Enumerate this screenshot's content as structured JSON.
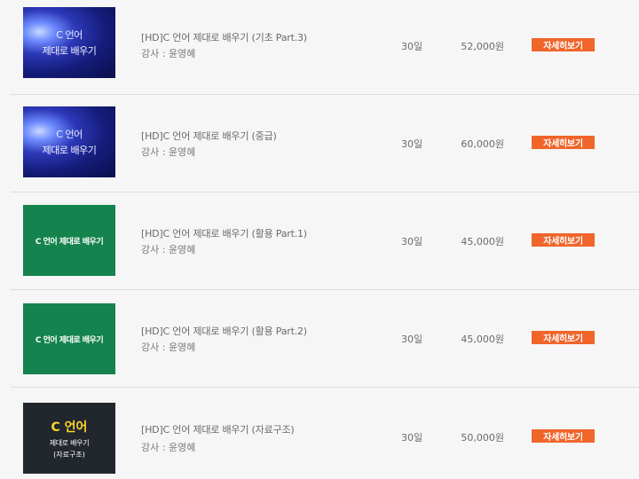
{
  "courses": [
    {
      "thumb_lines": [
        "C 언어",
        "제대로 배우기"
      ],
      "title": "[HD]C 언어 제대로 배우기 (기초 Part.3)",
      "teacher": "강사 : 윤영혜",
      "period": "30일",
      "price": "52,000원",
      "button": "자세히보기"
    },
    {
      "thumb_lines": [
        "C 언어",
        "제대로 배우기"
      ],
      "title": "[HD]C 언어 제대로 배우기 (중급)",
      "teacher": "강사 : 윤영혜",
      "period": "30일",
      "price": "60,000원",
      "button": "자세히보기"
    },
    {
      "thumb_lines": [
        "C 언어 제대로 배우기"
      ],
      "title": "[HD]C 언어 제대로 배우기 (활용 Part.1)",
      "teacher": "강사 : 윤영혜",
      "period": "30일",
      "price": "45,000원",
      "button": "자세히보기"
    },
    {
      "thumb_lines": [
        "C 언어 제대로 배우기"
      ],
      "title": "[HD]C 언어 제대로 배우기 (활용 Part.2)",
      "teacher": "강사 : 윤영혜",
      "period": "30일",
      "price": "45,000원",
      "button": "자세히보기"
    },
    {
      "thumb_lines": [
        "C 언어",
        "제대로 배우기",
        "(자료구조)"
      ],
      "title": "[HD]C 언어 제대로 배우기 (자료구조)",
      "teacher": "강사 : 윤영혜",
      "period": "30일",
      "price": "50,000원",
      "button": "자세히보기"
    }
  ],
  "colors": {
    "button": "#f0652a",
    "green_thumb": "#15834d",
    "blue_thumb": "#1c2590",
    "dark_thumb": "#22262d",
    "dark_thumb_title": "#ffd52a"
  }
}
